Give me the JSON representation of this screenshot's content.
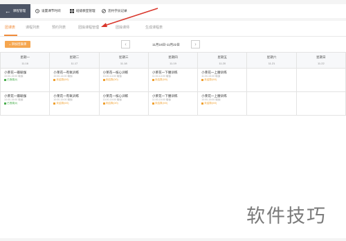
{
  "toolbar": {
    "back_label": "课程管理",
    "tools": [
      {
        "label": "设置课节时间",
        "icon": "clock-icon"
      },
      {
        "label": "班级教室管理",
        "icon": "grid-icon"
      },
      {
        "label": "违约学员记录",
        "icon": "ban-icon"
      }
    ]
  },
  "tabs": [
    "团课表",
    "课程列表",
    "预约列表",
    "团操课程管理",
    "团操课师",
    "生成课程表"
  ],
  "active_tab": 0,
  "add_button": "添加团操课",
  "date_range": "11月16日-11月22日",
  "days": [
    {
      "weekday": "星期一",
      "date": "11.16"
    },
    {
      "weekday": "星期二",
      "date": "11.17"
    },
    {
      "weekday": "星期三",
      "date": "11.18"
    },
    {
      "weekday": "星期四",
      "date": "11.19"
    },
    {
      "weekday": "星期五",
      "date": "11.20"
    },
    {
      "weekday": "星期六",
      "date": "11.21"
    },
    {
      "weekday": "星期日",
      "date": "11.22"
    }
  ],
  "rows": [
    [
      {
        "title": "小莱花一瓣瑜伽",
        "sub": "10:00-15:00 瑜伽",
        "status": "已授课(0)",
        "color": "green"
      },
      {
        "title": "小莱花一有氧训练",
        "sub": "10:00-14:00 瑜伽",
        "status": "未结算(0/0)",
        "color": "orange"
      },
      {
        "title": "小莱花一核心训练",
        "sub": "13:00-14:00 瑜伽",
        "status": "未结算(0/0)",
        "color": "orange"
      },
      {
        "title": "小莱花一下腰训练",
        "sub": "11:00-14:00 瑜伽",
        "status": "未结算(0/0)",
        "color": "orange"
      },
      {
        "title": "小莱花一上腰训练",
        "sub": "11:00-15:00 瑜伽",
        "status": "未结算(0/0)",
        "color": "orange"
      },
      null,
      null
    ],
    [
      {
        "title": "小莱花一瓣瑜伽",
        "sub": "10:00-15:00 瑜伽",
        "status": "已授课(0)",
        "color": "green"
      },
      {
        "title": "小莱花一有氧训练",
        "sub": "10:00-15:00 瑜伽",
        "status": "未结算(0/0)",
        "color": "orange"
      },
      {
        "title": "小莱花一核心训练",
        "sub": "13:00-15:00 瑜伽",
        "status": "未结算(0/0)",
        "color": "orange"
      },
      {
        "title": "小莱花一下腰训练",
        "sub": "11:00-15:00 瑜伽",
        "status": "未结算(0/0)",
        "color": "orange"
      },
      {
        "title": "小莱花一上腰训练",
        "sub": "10:00-15:00 瑜伽",
        "status": "未结算(0/0)",
        "color": "orange"
      },
      null,
      null
    ]
  ],
  "watermark": "软件技巧",
  "colors": {
    "accent": "#f08b3a",
    "annotation": "#d9362b",
    "completed": "#4caf50",
    "pending": "#f0a030"
  }
}
